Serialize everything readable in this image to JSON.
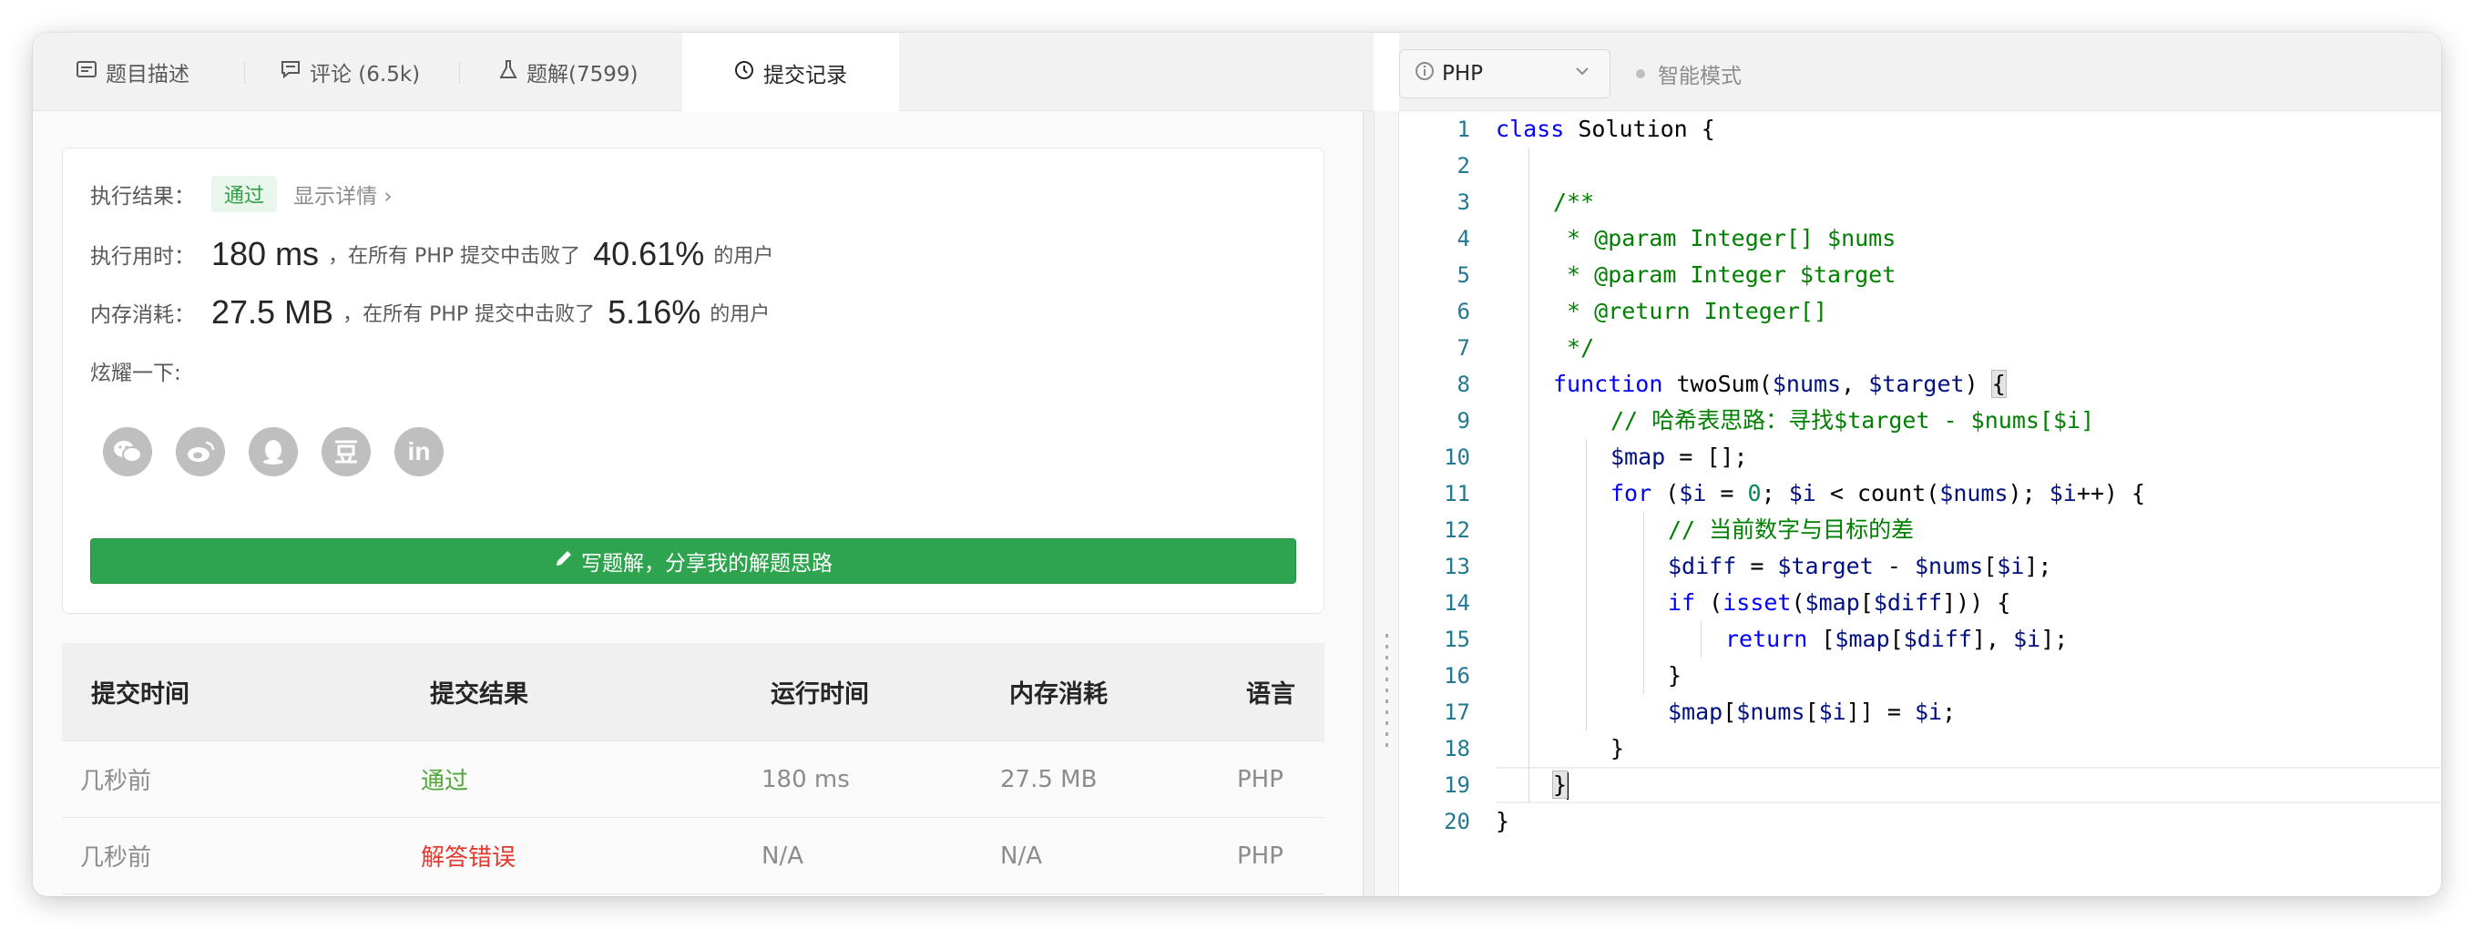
{
  "tabs": [
    {
      "label": "题目描述",
      "icon": "description-icon"
    },
    {
      "label": "评论 (6.5k)",
      "icon": "comment-icon"
    },
    {
      "label": "题解(7599)",
      "icon": "flask-icon"
    },
    {
      "label": "提交记录",
      "icon": "clock-icon"
    }
  ],
  "result": {
    "label": "执行结果：",
    "status": "通过",
    "detail_link": "显示详情 ›",
    "time_label": "执行用时：",
    "time_value": "180 ms",
    "time_text": "，在所有 PHP 提交中击败了",
    "time_percent": "40.61%",
    "time_suffix": "的用户",
    "mem_label": "内存消耗：",
    "mem_value": "27.5 MB",
    "mem_text": "，在所有 PHP 提交中击败了",
    "mem_percent": "5.16%",
    "mem_suffix": "的用户",
    "share_label": "炫耀一下:",
    "share_icons": [
      "wechat-icon",
      "weibo-icon",
      "qq-icon",
      "douban-icon",
      "linkedin-icon"
    ],
    "write_button": "写题解，分享我的解题思路"
  },
  "submissions": {
    "headers": [
      "提交时间",
      "提交结果",
      "运行时间",
      "内存消耗",
      "语言"
    ],
    "rows": [
      {
        "time": "几秒前",
        "result": "通过",
        "result_color": "#52a63a",
        "runtime": "180 ms",
        "memory": "27.5 MB",
        "lang": "PHP"
      },
      {
        "time": "几秒前",
        "result": "解答错误",
        "result_color": "#e5382f",
        "runtime": "N/A",
        "memory": "N/A",
        "lang": "PHP"
      }
    ]
  },
  "editor": {
    "language": "PHP",
    "mode_label": "智能模式",
    "line_numbers": [
      "1",
      "2",
      "3",
      "4",
      "5",
      "6",
      "7",
      "8",
      "9",
      "10",
      "11",
      "12",
      "13",
      "14",
      "15",
      "16",
      "17",
      "18",
      "19",
      "20"
    ],
    "code": {
      "l1a": "class",
      "l1b": " Solution {",
      "l3": "/**",
      "l4": " * @param Integer[] $nums",
      "l5": " * @param Integer $target",
      "l6": " * @return Integer[]",
      "l7": " */",
      "l8a": "function",
      "l8b": " twoSum(",
      "l8c": "$nums",
      "l8d": ", ",
      "l8e": "$target",
      "l8f": ") ",
      "l8g": "{",
      "l9": "// 哈希表思路：寻找$target - $nums[$i]",
      "l10a": "$map",
      "l10b": " = [];",
      "l11a": "for",
      "l11b": " (",
      "l11c": "$i",
      "l11d": " = ",
      "l11e": "0",
      "l11f": "; ",
      "l11g": "$i",
      "l11h": " < count(",
      "l11i": "$nums",
      "l11j": "); ",
      "l11k": "$i",
      "l11l": "++) {",
      "l12": "// 当前数字与目标的差",
      "l13a": "$diff",
      "l13b": " = ",
      "l13c": "$target",
      "l13d": " - ",
      "l13e": "$nums",
      "l13f": "[",
      "l13g": "$i",
      "l13h": "];",
      "l14a": "if",
      "l14b": " (",
      "l14c": "isset",
      "l14d": "(",
      "l14e": "$map",
      "l14f": "[",
      "l14g": "$diff",
      "l14h": "])) {",
      "l15a": "return",
      "l15b": " [",
      "l15c": "$map",
      "l15d": "[",
      "l15e": "$diff",
      "l15f": "], ",
      "l15g": "$i",
      "l15h": "];",
      "l16": "}",
      "l17a": "$map",
      "l17b": "[",
      "l17c": "$nums",
      "l17d": "[",
      "l17e": "$i",
      "l17f": "]] = ",
      "l17g": "$i",
      "l17h": ";",
      "l18": "}",
      "l19": "}",
      "l20": "}"
    }
  }
}
